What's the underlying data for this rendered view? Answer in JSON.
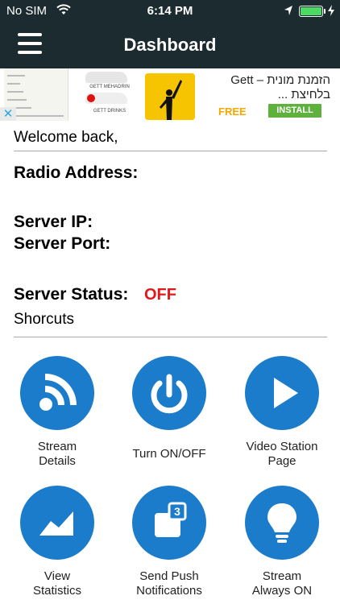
{
  "status_bar": {
    "carrier": "No SIM",
    "time": "6:14 PM",
    "battery_color": "#4cd964"
  },
  "nav": {
    "title": "Dashboard",
    "menu_icon": "hamburger-icon"
  },
  "ad": {
    "close_glyph": "✕",
    "title_line1": "הזמנת מונית – Gett",
    "title_line2": "בלחיצת ...",
    "free_label": "FREE",
    "install_label": "INSTALL",
    "mid_label_1": "GETT MEHADRIN",
    "mid_label_2": "GETT DRINKS"
  },
  "content": {
    "welcome": "Welcome back,",
    "radio_address_label": "Radio Address:",
    "server_ip_label": "Server IP:",
    "server_port_label": "Server Port:",
    "server_status_label": "Server Status:",
    "server_status_value": "OFF",
    "shortcuts_label": "Shorcuts"
  },
  "shortcuts": [
    {
      "icon": "rss-icon",
      "line1": "Stream",
      "line2": "Details"
    },
    {
      "icon": "power-icon",
      "line1": "Turn ON/OFF",
      "line2": ""
    },
    {
      "icon": "play-icon",
      "line1": "Video Station",
      "line2": "Page"
    },
    {
      "icon": "chart-icon",
      "line1": "View",
      "line2": "Statistics"
    },
    {
      "icon": "notification-badge-icon",
      "line1": "Send Push",
      "line2": "Notifications",
      "badge": "3"
    },
    {
      "icon": "lightbulb-icon",
      "line1": "Stream",
      "line2": "Always ON"
    }
  ],
  "colors": {
    "navbar": "#1c2b2f",
    "accent": "#1a7ccb",
    "status_off": "#e0181b"
  }
}
